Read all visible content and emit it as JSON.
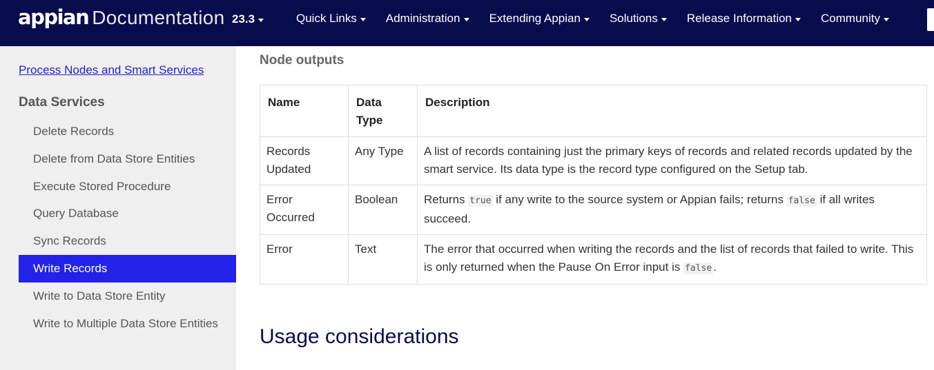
{
  "header": {
    "logo_brand": "appian",
    "logo_product": "Documentation",
    "version": "23.3",
    "nav": [
      "Quick Links",
      "Administration",
      "Extending Appian",
      "Solutions",
      "Release Information",
      "Community"
    ]
  },
  "sidebar": {
    "parent_link": "Process Nodes and Smart Services",
    "section_title": "Data Services",
    "items": [
      {
        "label": "Delete Records",
        "active": false
      },
      {
        "label": "Delete from Data Store Entities",
        "active": false
      },
      {
        "label": "Execute Stored Procedure",
        "active": false
      },
      {
        "label": "Query Database",
        "active": false
      },
      {
        "label": "Sync Records",
        "active": false
      },
      {
        "label": "Write Records",
        "active": true
      },
      {
        "label": "Write to Data Store Entity",
        "active": false
      },
      {
        "label": "Write to Multiple Data Store Entities",
        "active": false
      }
    ]
  },
  "main": {
    "section_heading": "Node outputs",
    "table": {
      "headers": [
        "Name",
        "Data Type",
        "Description"
      ],
      "rows": [
        {
          "name": "Records Updated",
          "type": "Any Type",
          "desc_parts": [
            {
              "text": "A list of records containing just the primary keys of records and related records updated by the smart service. Its data type is the record type configured on the Setup tab."
            }
          ]
        },
        {
          "name": "Error Occurred",
          "type": "Boolean",
          "desc_parts": [
            {
              "text": "Returns "
            },
            {
              "code": "true"
            },
            {
              "text": " if any write to the source system or Appian fails; returns "
            },
            {
              "code": "false"
            },
            {
              "text": " if all writes succeed."
            }
          ]
        },
        {
          "name": "Error",
          "type": "Text",
          "desc_parts": [
            {
              "text": "The error that occurred when writing the records and the list of records that failed to write. This is only returned when the Pause On Error input is "
            },
            {
              "code": "false"
            },
            {
              "text": "."
            }
          ]
        }
      ]
    },
    "next_heading": "Usage considerations"
  }
}
